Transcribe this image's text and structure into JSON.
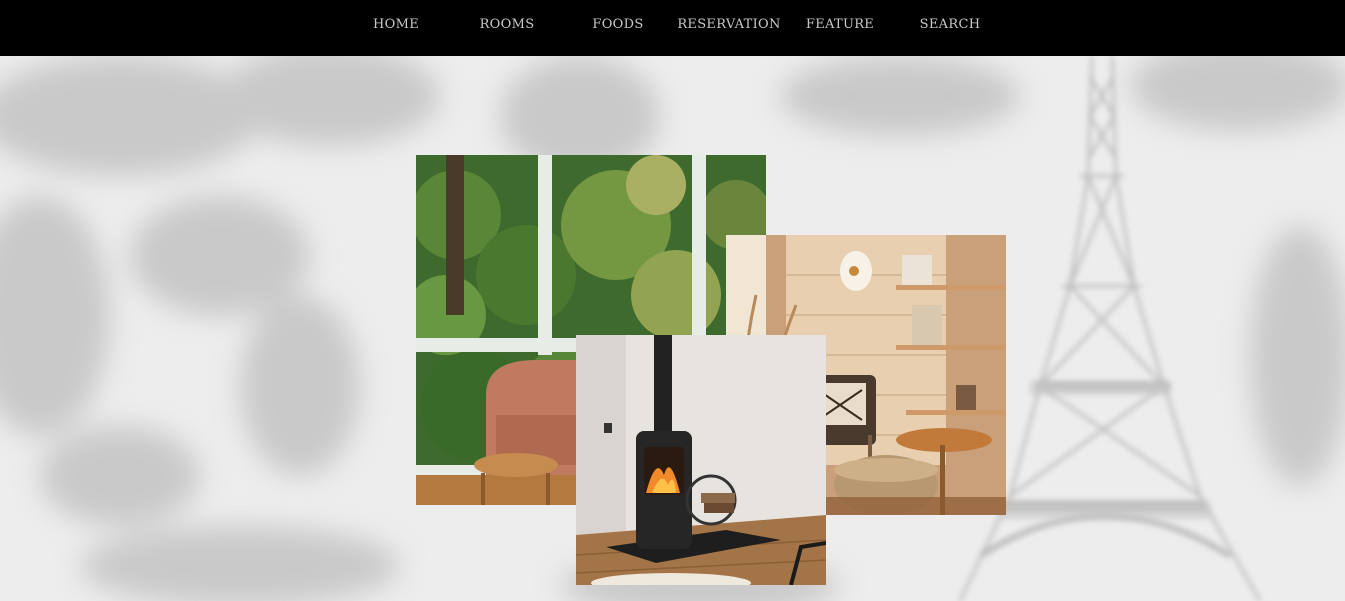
{
  "nav": {
    "items": [
      {
        "label": "HOME"
      },
      {
        "label": "ROOMS"
      },
      {
        "label": "FOODS"
      },
      {
        "label": "RESERVATION"
      },
      {
        "label": "FEATURE"
      },
      {
        "label": "SEARCH"
      }
    ]
  },
  "colors": {
    "navbar_bg": "#000000",
    "nav_text": "#c8c8c8",
    "page_bg": "#ececec"
  },
  "background": {
    "icon": "eiffel-tower-icon"
  },
  "gallery": {
    "photos": [
      {
        "name": "photo-window-armchair"
      },
      {
        "name": "photo-cozy-lounge"
      },
      {
        "name": "photo-wood-stove"
      }
    ]
  }
}
